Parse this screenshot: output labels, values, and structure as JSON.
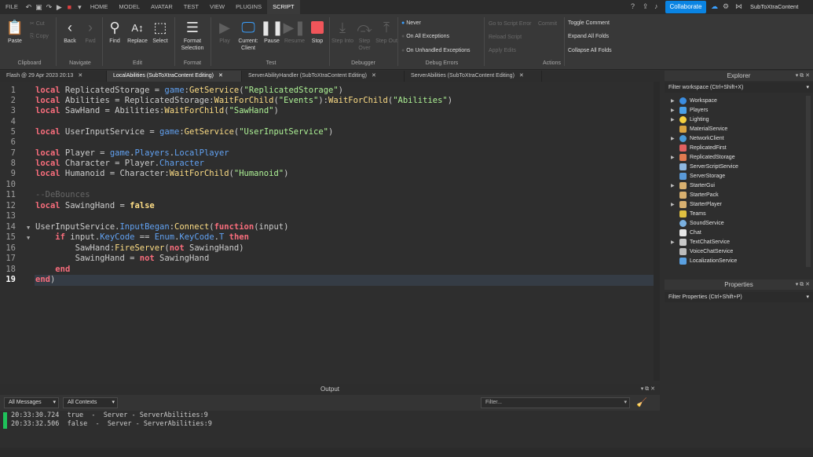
{
  "menubar": {
    "file": "FILE",
    "tabs": [
      "HOME",
      "MODEL",
      "AVATAR",
      "TEST",
      "VIEW",
      "PLUGINS",
      "SCRIPT"
    ],
    "collaborate": "Collaborate",
    "place": "SubToXtraContent"
  },
  "ribbon": {
    "paste": "Paste",
    "cut": "Cut",
    "copy": "Copy",
    "back": "Back",
    "fwd": "Fwd",
    "find": "Find",
    "replace": "Replace",
    "select": "Select",
    "format_selection": "Format Selection",
    "play": "Play",
    "current_client": "Current: Client",
    "pause": "Pause",
    "resume": "Resume",
    "stop": "Stop",
    "step_into": "Step Into",
    "step_over": "Step Over",
    "step_out": "Step Out",
    "never": "Never",
    "on_all": "On All Exceptions",
    "on_unhandled": "On Unhandled Exceptions",
    "goto_error": "Go to Script Error",
    "commit": "Commit",
    "reload": "Reload Script",
    "apply": "Apply Edits",
    "toggle_comment": "Toggle Comment",
    "expand_folds": "Expand All Folds",
    "collapse_folds": "Collapse All Folds",
    "groups": {
      "clipboard": "Clipboard",
      "navigate": "Navigate",
      "edit": "Edit",
      "format": "Format",
      "test": "Test",
      "debugger": "Debugger",
      "debug_errors": "Debug Errors",
      "actions": "Actions"
    }
  },
  "tabs": [
    {
      "label": "Flash @ 29 Apr 2023 20:13"
    },
    {
      "label": "LocalAbilities (SubToXtraContent Editing)"
    },
    {
      "label": "ServerAbilityHandler (SubToXtraContent Editing)"
    },
    {
      "label": "ServerAbilities (SubToXtraContent Editing)"
    }
  ],
  "editor": {
    "line_numbers": [
      "1",
      "2",
      "3",
      "4",
      "5",
      "6",
      "7",
      "8",
      "9",
      "10",
      "11",
      "12",
      "13",
      "14",
      "15",
      "16",
      "17",
      "18",
      "19"
    ]
  },
  "output": {
    "title": "Output",
    "filter_messages": "All Messages",
    "filter_contexts": "All Contexts",
    "filter_placeholder": "Filter...",
    "logs": [
      "20:33:30.724  true  -  Server - ServerAbilities:9",
      "20:33:32.506  false  -  Server - ServerAbilities:9"
    ]
  },
  "explorer": {
    "title": "Explorer",
    "filter": "Filter workspace (Ctrl+Shift+X)",
    "items": [
      "Workspace",
      "Players",
      "Lighting",
      "MaterialService",
      "NetworkClient",
      "ReplicatedFirst",
      "ReplicatedStorage",
      "ServerScriptService",
      "ServerStorage",
      "StarterGui",
      "StarterPack",
      "StarterPlayer",
      "Teams",
      "SoundService",
      "Chat",
      "TextChatService",
      "VoiceChatService",
      "LocalizationService"
    ]
  },
  "properties": {
    "title": "Properties",
    "filter": "Filter Properties (Ctrl+Shift+P)"
  },
  "colors": {
    "accent": "#0a84e3",
    "keyword": "#f86d7c",
    "function": "#fddd85",
    "string": "#adf195",
    "property": "#61a1f1",
    "log_marker": "#1fc15a"
  }
}
